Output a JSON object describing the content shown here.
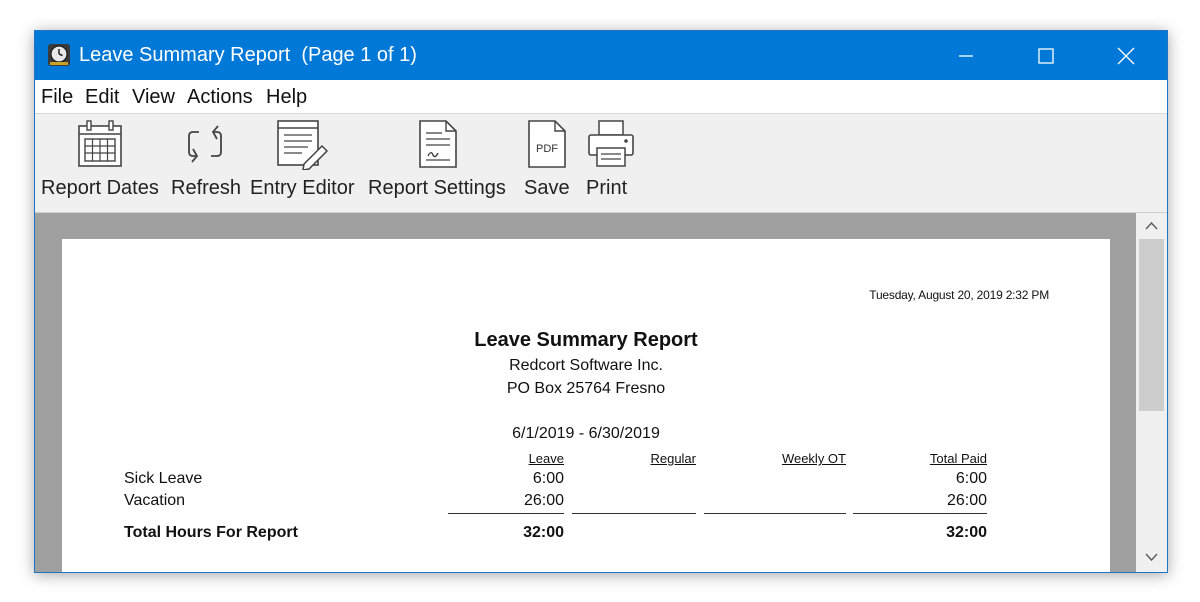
{
  "window": {
    "title": "Leave Summary Report  (Page 1 of 1)",
    "controls": [
      "minimize",
      "maximize",
      "close"
    ]
  },
  "menu": [
    "File",
    "Edit",
    "View",
    "Actions",
    "Help"
  ],
  "toolbar": [
    {
      "label": "Report Dates",
      "icon": "calendar-icon"
    },
    {
      "label": "Refresh",
      "icon": "refresh-icon"
    },
    {
      "label": "Entry Editor",
      "icon": "entry-editor-icon"
    },
    {
      "label": "Report Settings",
      "icon": "report-settings-icon"
    },
    {
      "label": "Save",
      "icon": "pdf-icon"
    },
    {
      "label": "Print",
      "icon": "printer-icon"
    }
  ],
  "icon_text": {
    "pdf": "PDF"
  },
  "report": {
    "timestamp": "Tuesday, August 20, 2019  2:32 PM",
    "title": "Leave Summary Report",
    "company": "Redcort Software Inc.",
    "address": "PO Box 25764  Fresno",
    "date_range": "6/1/2019 - 6/30/2019",
    "columns": [
      "Leave",
      "Regular",
      "Weekly OT",
      "Total Paid"
    ],
    "rows": [
      {
        "label": "Sick Leave",
        "leave": "6:00",
        "regular": "",
        "weekly_ot": "",
        "total_paid": "6:00"
      },
      {
        "label": "Vacation",
        "leave": "26:00",
        "regular": "",
        "weekly_ot": "",
        "total_paid": "26:00"
      }
    ],
    "total": {
      "label": "Total Hours For Report",
      "leave": "32:00",
      "regular": "",
      "weekly_ot": "",
      "total_paid": "32:00"
    }
  },
  "colors": {
    "titlebar": "#0078d7",
    "viewport": "#a0a0a0",
    "toolbar": "#f0f0f0"
  }
}
